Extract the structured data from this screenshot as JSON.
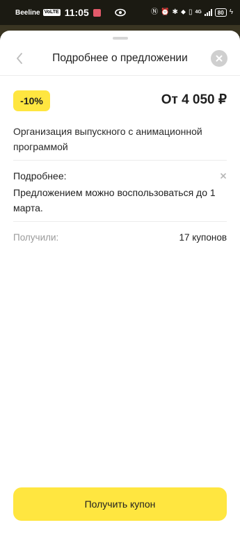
{
  "status_bar": {
    "carrier": "Beeline",
    "volte": "VoLTE",
    "time": "11:05",
    "network": "4G",
    "battery": "80",
    "icons": [
      "eye-icon",
      "nfc-icon",
      "alarm-icon",
      "bluetooth-icon",
      "location-icon",
      "vibrate-icon",
      "signal-icon",
      "battery-icon"
    ]
  },
  "sheet": {
    "title": "Подробнее о предложении",
    "back_icon": "chevron-left-icon",
    "close_icon": "close-icon"
  },
  "offer": {
    "discount": "-10%",
    "price": "От 4 050 ₽",
    "description": "Организация выпускного с анимационной программой",
    "details_label": "Подробнее:",
    "details_text": "Предложением можно воспользоваться до 1 марта.",
    "received_label": "Получили:",
    "received_value": "17 купонов"
  },
  "cta": {
    "label": "Получить купон"
  },
  "colors": {
    "accent": "#ffe640",
    "muted_text": "#9a9a9a",
    "close_bg": "#cfcfcf"
  }
}
